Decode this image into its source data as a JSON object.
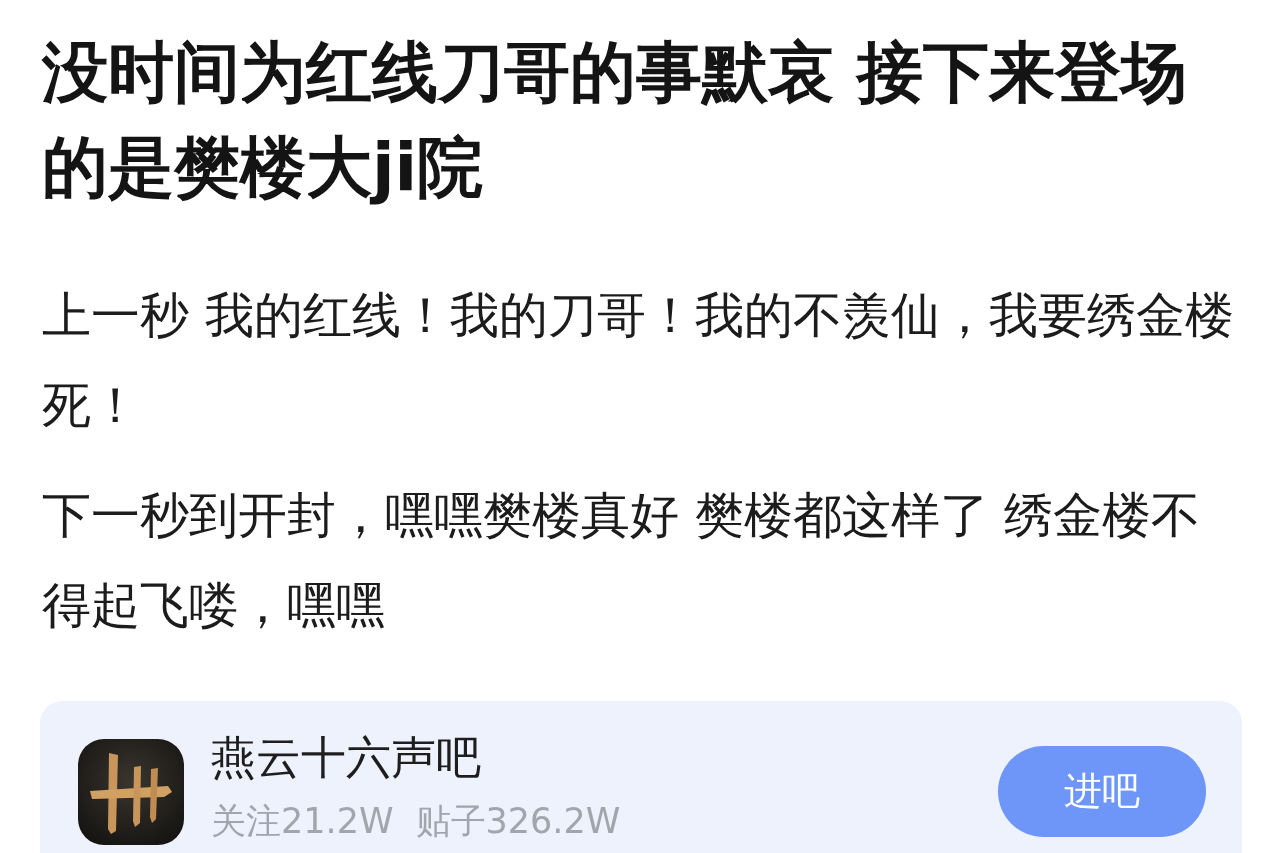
{
  "post": {
    "title": "没时间为红线刀哥的事默哀 接下来登场的是樊楼大ji院",
    "paragraphs": [
      "上一秒 我的红线！我的刀哥！我的不羡仙，我要绣金楼死！",
      "下一秒到开封，嘿嘿樊楼真好 樊楼都这样了 绣金楼不得起飞喽，嘿嘿"
    ]
  },
  "forum_card": {
    "name": "燕云十六声吧",
    "stats": [
      "关注21.2W",
      "贴子326.2W"
    ],
    "button": "进吧"
  }
}
